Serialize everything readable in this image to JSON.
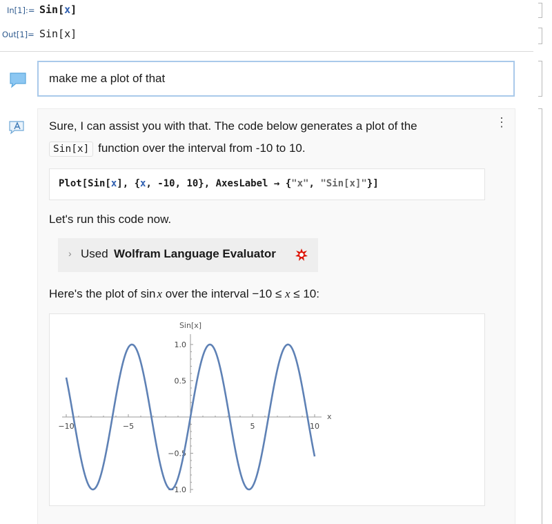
{
  "input_cell": {
    "label": "In[1]:=",
    "code_head": "Sin[",
    "code_var": "x",
    "code_tail": "]"
  },
  "output_cell": {
    "label": "Out[1]=",
    "value": "Sin[x]"
  },
  "user_message": {
    "text": "make me a plot of that"
  },
  "assistant": {
    "line1": "Sure, I can assist you with that. The code below generates a plot of the",
    "line2_code": "Sin[x]",
    "line2_text": "function over the interval from -10 to 10.",
    "code_block": {
      "p1": "Plot[Sin[",
      "p2": "x",
      "p3": "], {",
      "p4": "x",
      "p5": ", -10, 10}, AxesLabel → {",
      "p6": "\"x\"",
      "p7": ", ",
      "p8": "\"Sin[x]\"",
      "p9": "}]"
    },
    "run_text": "Let's run this code now.",
    "tool": {
      "prefix": "Used",
      "name": "Wolfram Language Evaluator"
    },
    "plot_intro_a": "Here's the plot of sin",
    "plot_intro_var": "x",
    "plot_intro_b": " over the interval −10 ≤ ",
    "plot_intro_var2": "x",
    "plot_intro_c": " ≤ 10:"
  },
  "chart_data": {
    "type": "line",
    "function": "Sin[x]",
    "xlabel": "x",
    "ylabel": "Sin[x]",
    "xlim": [
      -10,
      10
    ],
    "ylim": [
      -1,
      1
    ],
    "x_ticks": [
      "−10",
      "−5",
      "5",
      "10"
    ],
    "y_ticks": [
      "1.0",
      "0.5",
      "−0.5",
      "−1.0"
    ],
    "series": [
      {
        "color": "#5e81b5"
      }
    ]
  }
}
